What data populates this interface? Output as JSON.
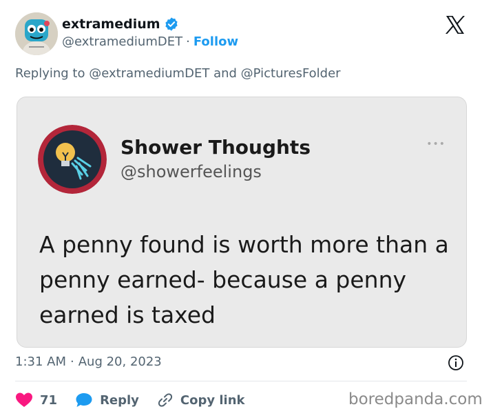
{
  "author": {
    "display_name": "extramedium",
    "handle": "@extramediumDET",
    "separator": "·",
    "follow_label": "Follow"
  },
  "reply_context": {
    "prefix": "Replying to",
    "mention_1": "@extramediumDET",
    "conjunction": "and",
    "mention_2": "@PicturesFolder"
  },
  "quoted_post": {
    "display_name": "Shower Thoughts",
    "handle": "@showerfeelings",
    "more": "•••",
    "text": "A penny found is worth more than a penny earned- because a penny earned is taxed"
  },
  "meta": {
    "time": "1:31 AM",
    "separator": "·",
    "date": "Aug 20, 2023"
  },
  "actions": {
    "like_count": "71",
    "reply_label": "Reply",
    "copy_label": "Copy link"
  },
  "watermark": "boredpanda.com",
  "colors": {
    "accent": "#1d9bf0",
    "like": "#f91880",
    "muted": "#536471"
  }
}
